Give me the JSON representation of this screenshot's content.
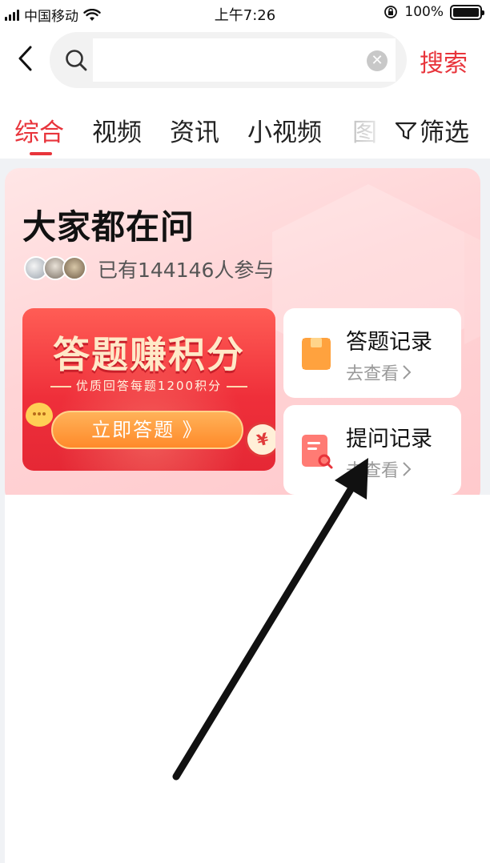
{
  "status_bar": {
    "carrier": "中国移动",
    "time": "上午7:26",
    "battery": "100%",
    "battery_level": 1.0
  },
  "header": {
    "search_placeholder": "",
    "search_value": "",
    "search_button": "搜索"
  },
  "tabs": {
    "items": [
      "综合",
      "视频",
      "资讯",
      "小视频",
      "图"
    ],
    "active_index": 0,
    "filter_label": "筛选"
  },
  "card": {
    "title": "大家都在问",
    "participants": "已有144146人参与",
    "banner": {
      "title": "答题赚积分",
      "subtitle": "优质回答每题1200积分",
      "button": "立即答题 》"
    },
    "records": [
      {
        "title": "答题记录",
        "link": "去查看"
      },
      {
        "title": "提问记录",
        "link": "去查看"
      }
    ]
  },
  "colors": {
    "accent": "#e8343b",
    "card_bg": "#ffd4d6",
    "banner_red": "#ef2f3a",
    "button_orange": "#ff8a2a"
  },
  "icons": [
    "signal-icon",
    "wifi-icon",
    "orientation-lock-icon",
    "battery-icon",
    "back-icon",
    "search-icon",
    "clear-icon",
    "filter-icon",
    "folder-icon",
    "document-search-icon",
    "chevron-right-icon",
    "chat-bubble-icon",
    "coin-icon"
  ]
}
